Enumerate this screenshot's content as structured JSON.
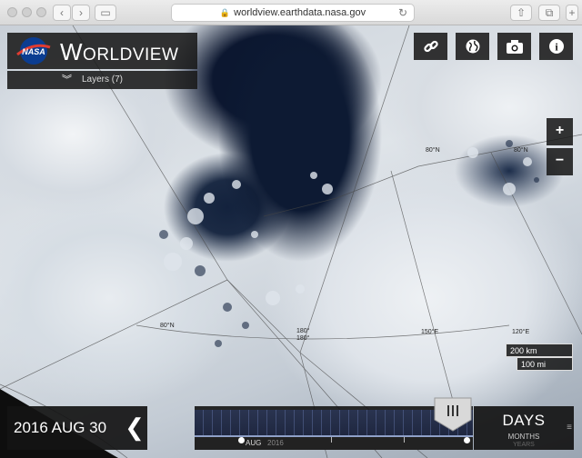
{
  "browser": {
    "url": "worldview.earthdata.nasa.gov",
    "back_icon": "chevron-left-icon",
    "forward_icon": "chevron-right-icon"
  },
  "app": {
    "nasa_logo_text": "NASA",
    "title_big": "W",
    "title_rest": "ORLDVIEW",
    "layers_label": "Layers (7)"
  },
  "tools": {
    "link_icon": "link-icon",
    "globe_icon": "globe-icon",
    "camera_icon": "camera-icon",
    "info_label": "i"
  },
  "zoom": {
    "in": "+",
    "out": "−"
  },
  "map_labels": {
    "lat80_left": "80°N",
    "lat80_right": "80°N",
    "lon180": "180°",
    "lon150e": "150°E",
    "lon120e": "120°E",
    "mid80": "80°N"
  },
  "scale": {
    "km": "200 km",
    "mi": "100 mi"
  },
  "timeline": {
    "date": "2016 AUG 30",
    "month_label": "AUG",
    "year_label": "2016",
    "zoom_level": "DAYS",
    "zoom_next": "MONTHS",
    "zoom_next2": "YEARS",
    "play_icon": "chevron-left-icon"
  },
  "colors": {
    "panel": "#191919",
    "ocean": "#0d1a33",
    "ice": "#e4e8ec"
  }
}
